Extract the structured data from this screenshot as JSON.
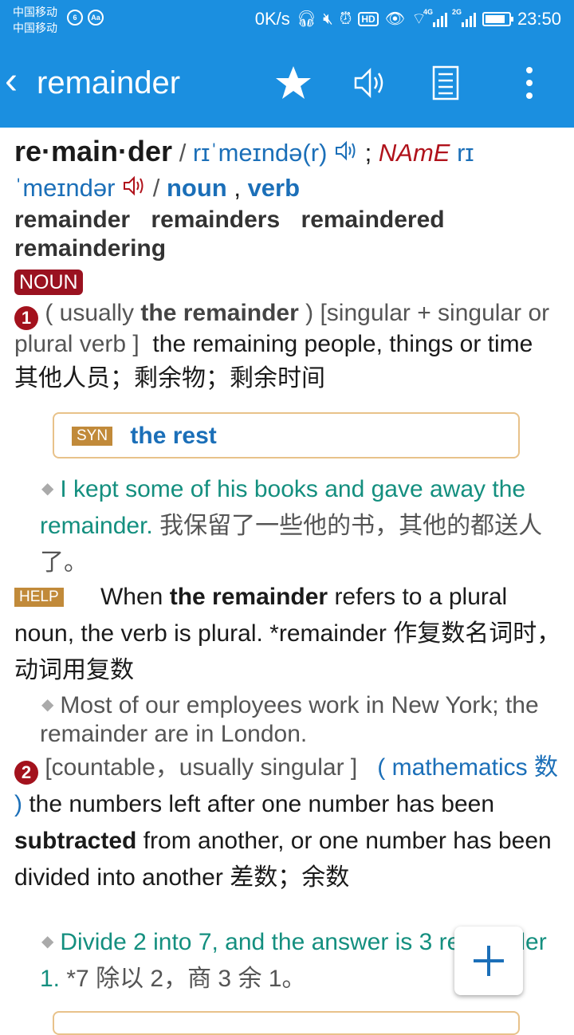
{
  "status": {
    "carrier1": "中国移动",
    "carrier2": "中国移动",
    "speed": "0K/s",
    "time": "23:50",
    "net_4g": "4G",
    "net_2g": "2G",
    "hd": "HD"
  },
  "toolbar": {
    "title": "remainder"
  },
  "entry": {
    "headword": "re·main·der",
    "br_pron": "rɪˈmeɪndə(r)",
    "name_label": "NAmE",
    "am_pron_a": "rɪ",
    "am_pron_b": "ˈmeɪndər",
    "pos1": "noun",
    "pos2": "verb",
    "forms": [
      "remainder",
      "remainders",
      "remaindered",
      "remaindering"
    ],
    "pos_badge": "NOUN"
  },
  "sense1": {
    "number": "1",
    "usually_pre": "( usually ",
    "usually_bold": "the remainder",
    "usually_post": " )",
    "grammar": "[singular + singular or plural verb ]",
    "definition": "the remaining people, things or time",
    "translation": "其他人员；剩余物；剩余时间",
    "syn_tag": "SYN",
    "syn": "the rest",
    "example": "I kept some of his books and gave away the remainder.",
    "example_tr": "我保留了一些他的书，其他的都送人了。"
  },
  "help": {
    "tag": "HELP",
    "pre": "When ",
    "bold": "the remainder",
    "post": " refers to a plural noun, the verb is plural. *remainder 作复数名词时，动词用复数",
    "example": "Most of our employees work in New York; the remainder are in London."
  },
  "sense2": {
    "number": "2",
    "grammar": "[countable，usually singular ]",
    "subject": "( mathematics 数 )",
    "def_pre": "the numbers left after one number has been ",
    "def_bold": "subtracted",
    "def_post": " from another, or one number has been divided into another 差数；余数",
    "example": "Divide 2 into 7, and the answer is 3 remainder 1.",
    "example_tr": "*7 除以 2，商 3 余 1。"
  }
}
